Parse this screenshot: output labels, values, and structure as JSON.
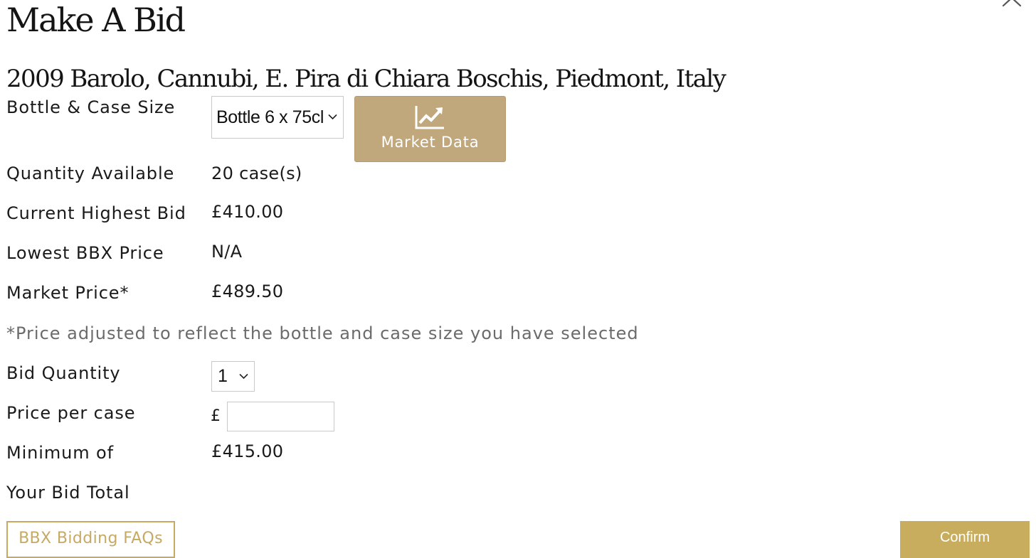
{
  "modal": {
    "title": "Make A Bid",
    "close_icon": "close-icon"
  },
  "wine": {
    "name": "2009 Barolo, Cannubi, E. Pira di Chiara Boschis, Piedmont, Italy"
  },
  "size": {
    "label": "Bottle & Case Size",
    "selected": "Bottle 6 x 75cl"
  },
  "market_data": {
    "label": "Market Data",
    "icon": "line-chart-icon"
  },
  "details": {
    "quantity_available_label": "Quantity Available",
    "quantity_available_value": "20 case(s)",
    "current_highest_bid_label": "Current Highest Bid",
    "current_highest_bid_value": "£410.00",
    "lowest_bbx_price_label": "Lowest BBX Price",
    "lowest_bbx_price_value": "N/A",
    "market_price_label": "Market Price*",
    "market_price_value": "£489.50",
    "note": "*Price adjusted to reflect the bottle and case size you have selected"
  },
  "bid": {
    "quantity_label": "Bid Quantity",
    "quantity_selected": "1",
    "price_label": "Price per case",
    "currency_symbol": "£",
    "price_value": "",
    "minimum_label": "Minimum of",
    "minimum_value": "£415.00",
    "total_label": "Your Bid Total",
    "total_value": ""
  },
  "footer": {
    "faq_label": "BBX Bidding FAQs",
    "confirm_label": "Confirm"
  },
  "colors": {
    "market_data_button": "#c0a77c",
    "confirm_button": "#c8ad5e",
    "faq_border": "#c7a963",
    "note_text": "#6b6b6b"
  }
}
